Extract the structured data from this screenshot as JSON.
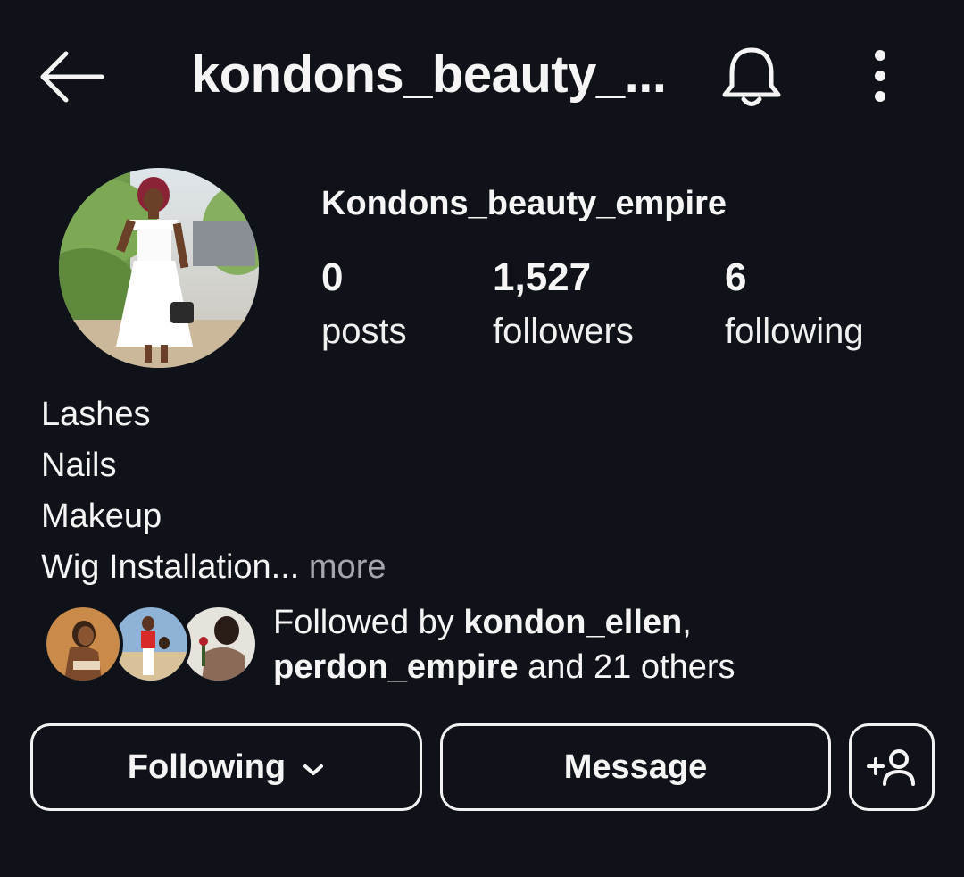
{
  "header": {
    "title": "kondons_beauty_..."
  },
  "profile": {
    "username": "Kondons_beauty_empire",
    "stats": [
      {
        "value": "0",
        "label": "posts"
      },
      {
        "value": "1,527",
        "label": "followers"
      },
      {
        "value": "6",
        "label": "following"
      }
    ],
    "bio": {
      "lines": [
        "Lashes",
        "Nails",
        "Makeup"
      ],
      "truncated_line": "Wig Installation...",
      "more_label": "more"
    }
  },
  "followed_by": {
    "prefix": "Followed by",
    "user1": "kondon_ellen",
    "comma": ",",
    "user2": "perdon_empire",
    "and_text": "and 21 others"
  },
  "actions": {
    "following_label": "Following",
    "message_label": "Message"
  },
  "icons": {
    "back": "arrow-left-icon",
    "bell": "bell-icon",
    "more": "more-vertical-icon",
    "chevron": "chevron-down-icon",
    "add_user": "add-user-icon"
  },
  "colors": {
    "background": "#0f1218",
    "text": "#f5f5f5",
    "muted": "#a3a6ad"
  }
}
